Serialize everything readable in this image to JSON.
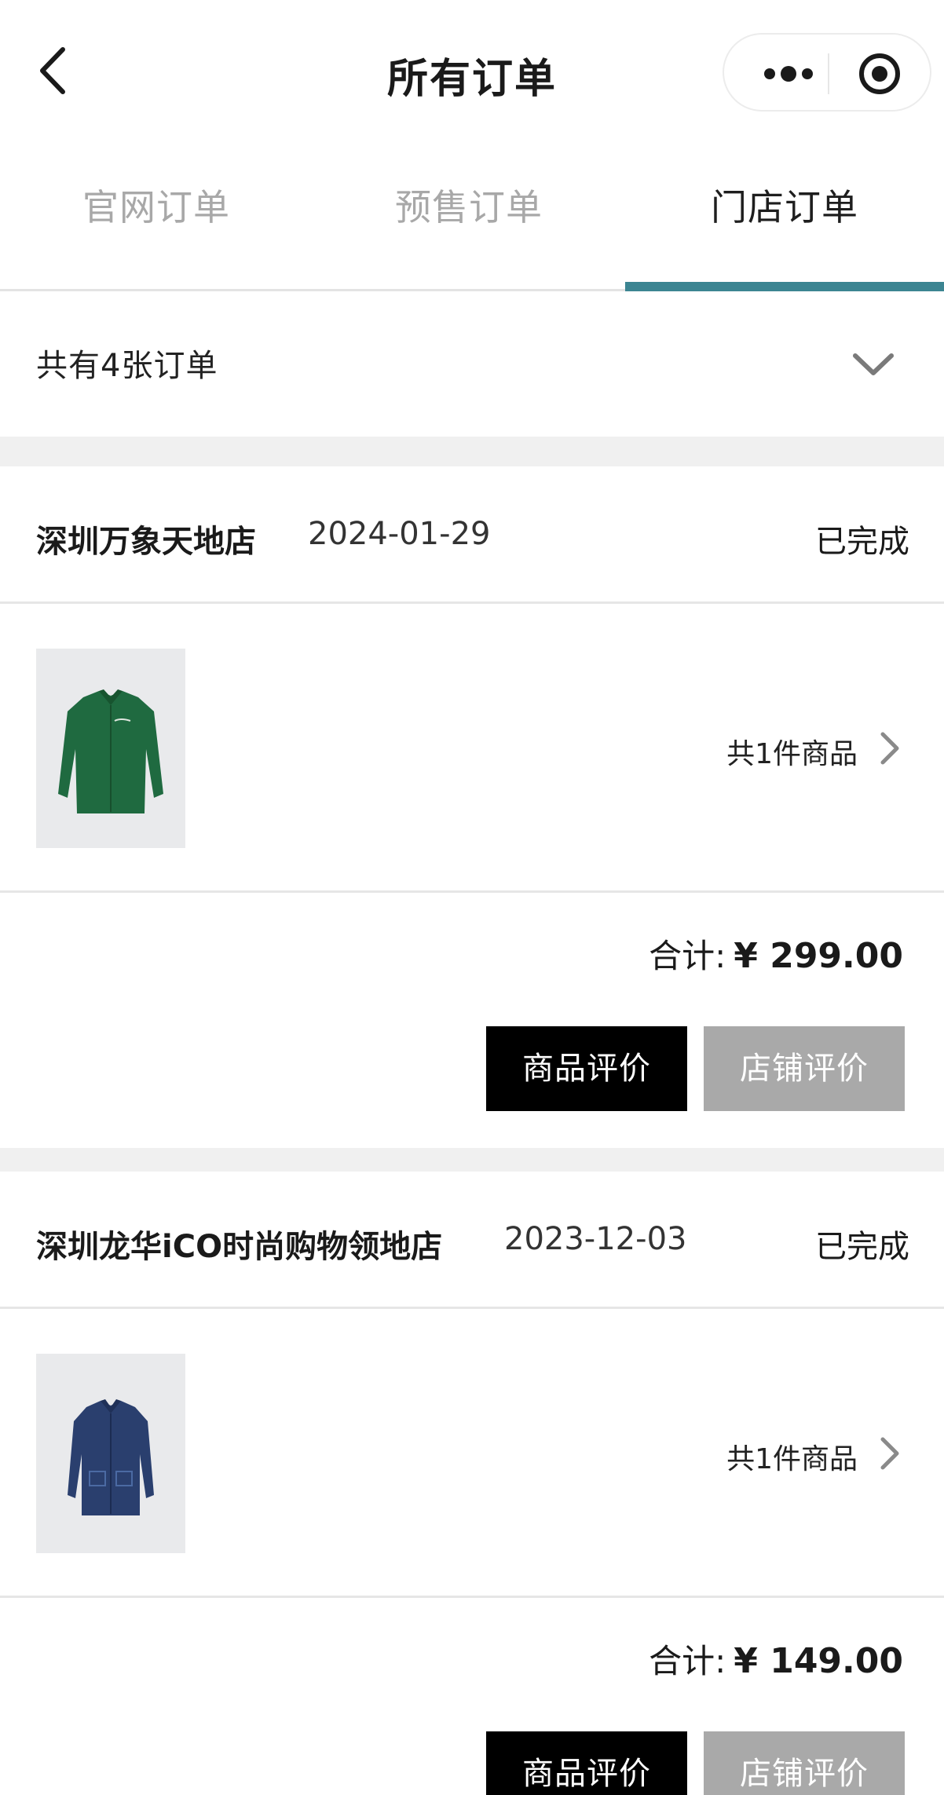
{
  "header": {
    "title": "所有订单",
    "back_icon": "chevron-left-icon",
    "more_icon": "more-dots-icon",
    "close_icon": "target-circle-icon"
  },
  "tabs": [
    {
      "label": "官网订单",
      "active": false
    },
    {
      "label": "预售订单",
      "active": false
    },
    {
      "label": "门店订单",
      "active": true
    }
  ],
  "accent_color": "#3c8592",
  "summary": {
    "text": "共有4张订单",
    "icon": "chevron-down-icon"
  },
  "orders": [
    {
      "store": "深圳万象天地店",
      "date": "2024-01-29",
      "status": "已完成",
      "product_image": "green-jacket",
      "item_count": "共1件商品",
      "total_label": "合计:",
      "total_amount": "¥ 299.00",
      "review_product": "商品评价",
      "review_store": "店铺评价"
    },
    {
      "store": "深圳龙华iCO时尚购物领地店",
      "date": "2023-12-03",
      "status": "已完成",
      "product_image": "denim-jacket",
      "item_count": "共1件商品",
      "total_label": "合计:",
      "total_amount": "¥ 149.00",
      "review_product": "商品评价",
      "review_store": "店铺评价"
    }
  ]
}
